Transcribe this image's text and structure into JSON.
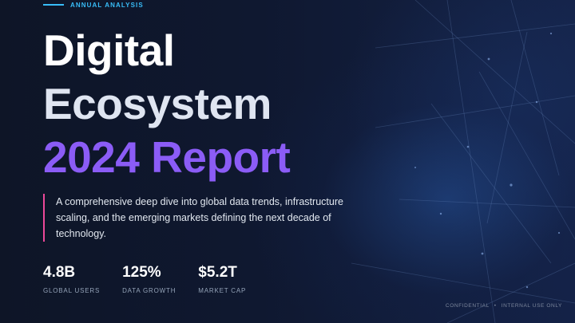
{
  "eyebrow": {
    "text": "ANNUAL ANALYSIS"
  },
  "title": {
    "line1": "Digital",
    "line2": "Ecosystem",
    "line3": "2024 Report"
  },
  "description": "A comprehensive deep dive into global data trends, infrastructure scaling, and the emerging markets defining the next decade of technology.",
  "stats": [
    {
      "value": "4.8B",
      "label": "GLOBAL USERS"
    },
    {
      "value": "125%",
      "label": "DATA GROWTH"
    },
    {
      "value": "$5.2T",
      "label": "MARKET CAP"
    }
  ],
  "footer": {
    "left": "CONFIDENTIAL",
    "separator": "•",
    "right": "INTERNAL USE ONLY"
  },
  "colors": {
    "accent_cyan": "#38bdf8",
    "accent_purple": "#8b5cf6",
    "accent_pink": "#ec4899",
    "background": "#0f1629"
  }
}
